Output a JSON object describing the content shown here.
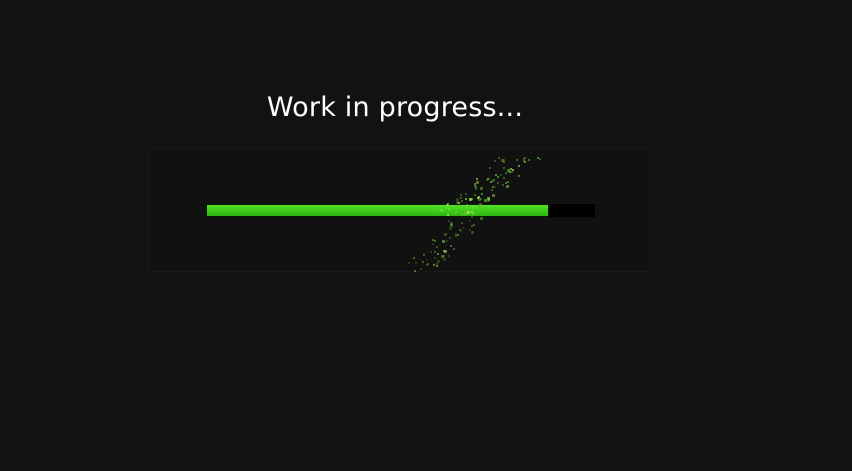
{
  "title": "Work in progress...",
  "progress": {
    "value": 0.88
  },
  "colors": {
    "background": "#121212",
    "bar_fill": "#3fcf1a",
    "bar_track": "#000000",
    "particle": "#6fd135"
  }
}
